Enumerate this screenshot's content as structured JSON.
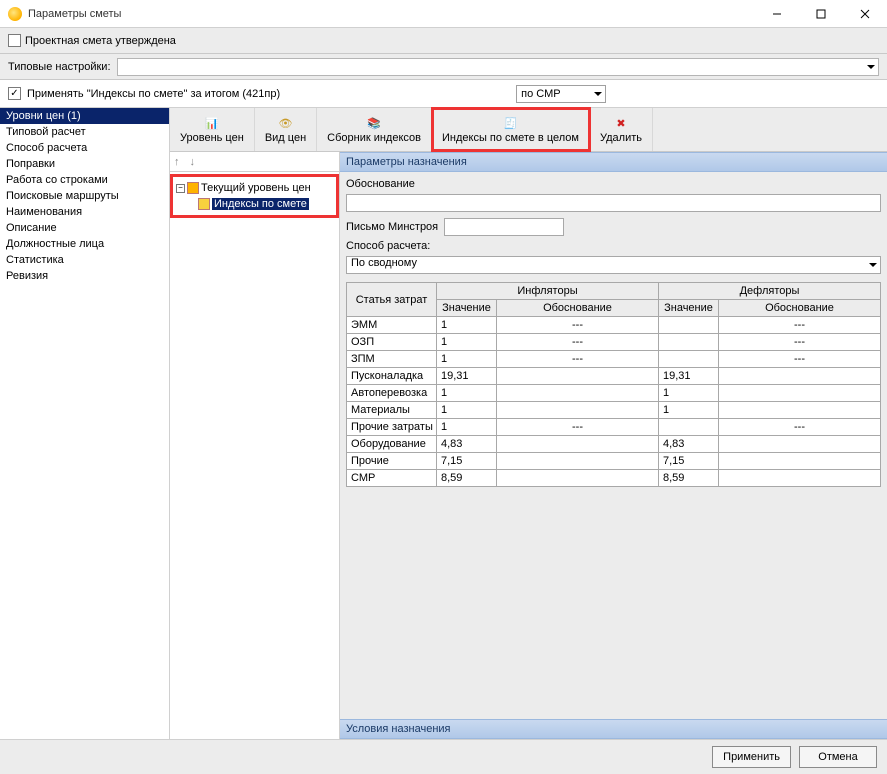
{
  "window": {
    "title": "Параметры сметы"
  },
  "approved": {
    "label": "Проектная смета утверждена",
    "checked": false
  },
  "typical": {
    "label": "Типовые настройки:"
  },
  "apply_indices": {
    "checked": true,
    "label": "Применять \"Индексы по смете\" за итогом (421пр)",
    "smr_label": "по СМР"
  },
  "leftnav": {
    "items": [
      "Уровни цен (1)",
      "Типовой расчет",
      "Способ расчета",
      "Поправки",
      "Работа со строками",
      "Поисковые маршруты",
      "Наименования",
      "Описание",
      "Должностные лица",
      "Статистика",
      "Ревизия"
    ],
    "selected_index": 0
  },
  "toolbar": {
    "items": [
      "Уровень цен",
      "Вид цен",
      "Сборник индексов",
      "Индексы по смете в целом",
      "Удалить"
    ],
    "highlight_index": 3
  },
  "tree": {
    "root": "Текущий уровень цен",
    "child": "Индексы по смете"
  },
  "params": {
    "header": "Параметры назначения",
    "basis_label": "Обоснование",
    "letter_label": "Письмо Минстроя",
    "method_label": "Способ расчета:",
    "method_value": "По сводному",
    "cond_header": "Условия назначения"
  },
  "table": {
    "col_item": "Статья затрат",
    "col_infl": "Инфляторы",
    "col_defl": "Дефляторы",
    "col_val": "Значение",
    "col_basis": "Обоснование",
    "rows": [
      {
        "name": "ЭММ",
        "iv": "1",
        "ib": "---",
        "dv": "",
        "db": "---"
      },
      {
        "name": "ОЗП",
        "iv": "1",
        "ib": "---",
        "dv": "",
        "db": "---"
      },
      {
        "name": "ЗПМ",
        "iv": "1",
        "ib": "---",
        "dv": "",
        "db": "---"
      },
      {
        "name": "Пусконаладка",
        "iv": "19,31",
        "ib": "",
        "dv": "19,31",
        "db": ""
      },
      {
        "name": "Автоперевозка",
        "iv": "1",
        "ib": "",
        "dv": "1",
        "db": ""
      },
      {
        "name": "Материалы",
        "iv": "1",
        "ib": "",
        "dv": "1",
        "db": ""
      },
      {
        "name": "Прочие затраты",
        "iv": "1",
        "ib": "---",
        "dv": "",
        "db": "---"
      },
      {
        "name": "Оборудование",
        "iv": "4,83",
        "ib": "",
        "dv": "4,83",
        "db": ""
      },
      {
        "name": "Прочие",
        "iv": "7,15",
        "ib": "",
        "dv": "7,15",
        "db": ""
      },
      {
        "name": "СМР",
        "iv": "8,59",
        "ib": "",
        "dv": "8,59",
        "db": ""
      }
    ]
  },
  "footer": {
    "apply": "Применить",
    "cancel": "Отмена"
  }
}
